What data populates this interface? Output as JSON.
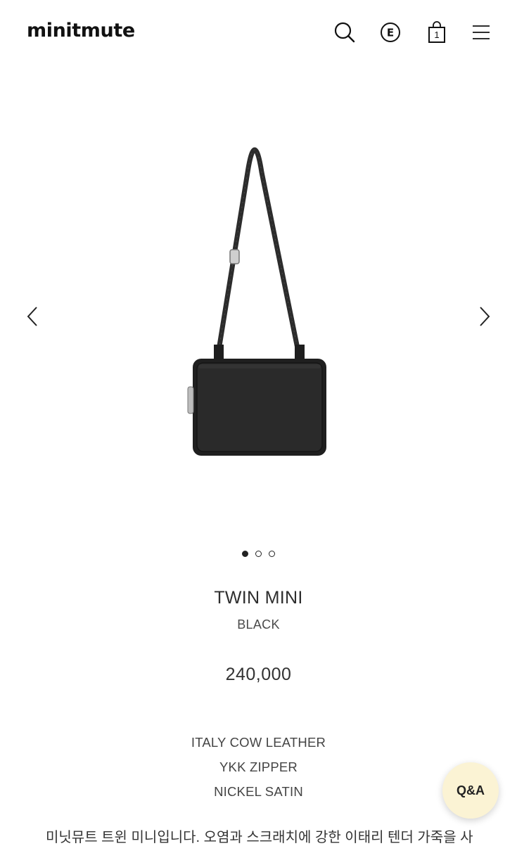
{
  "header": {
    "logo": "minitmute",
    "icons": [
      "search-icon",
      "e-circle-icon",
      "cart-icon",
      "menu-icon"
    ],
    "cart_count": "1"
  },
  "gallery": {
    "slide_count": 3,
    "active_slide": 1,
    "product_image": "black-crossbody-bag"
  },
  "product": {
    "name": "TWIN MINI",
    "color": "BLACK",
    "price": "240,000",
    "features": [
      "ITALY COW LEATHER",
      "YKK ZIPPER",
      "NICKEL SATIN"
    ],
    "description": "미닛뮤트 트윈 미니입니다. 오염과 스크래치에 강한 이태리 텐더 가죽을 사"
  },
  "qa_button": {
    "label": "Q&A"
  }
}
